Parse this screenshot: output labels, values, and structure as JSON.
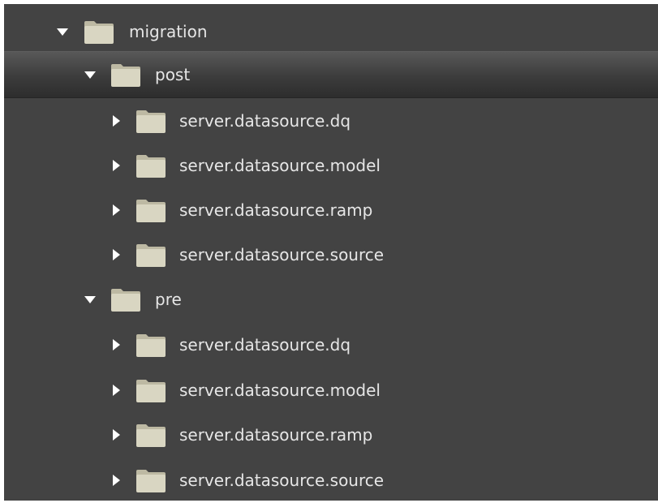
{
  "tree": {
    "root": {
      "label": "migration",
      "expanded": true,
      "icon": "folder-icon"
    },
    "groups": [
      {
        "label": "post",
        "expanded": true,
        "selected": true,
        "children": [
          {
            "label": "server.datasource.dq",
            "expanded": false
          },
          {
            "label": "server.datasource.model",
            "expanded": false
          },
          {
            "label": "server.datasource.ramp",
            "expanded": false
          },
          {
            "label": "server.datasource.source",
            "expanded": false
          }
        ]
      },
      {
        "label": "pre",
        "expanded": true,
        "selected": false,
        "children": [
          {
            "label": "server.datasource.dq",
            "expanded": false
          },
          {
            "label": "server.datasource.model",
            "expanded": false
          },
          {
            "label": "server.datasource.ramp",
            "expanded": false
          },
          {
            "label": "server.datasource.source",
            "expanded": false
          }
        ]
      }
    ]
  },
  "colors": {
    "background": "#434343",
    "text": "#e6e6e6",
    "arrow": "#ffffff",
    "folder_fill": "#d9d6c2",
    "folder_tab": "#bdb9a3"
  }
}
